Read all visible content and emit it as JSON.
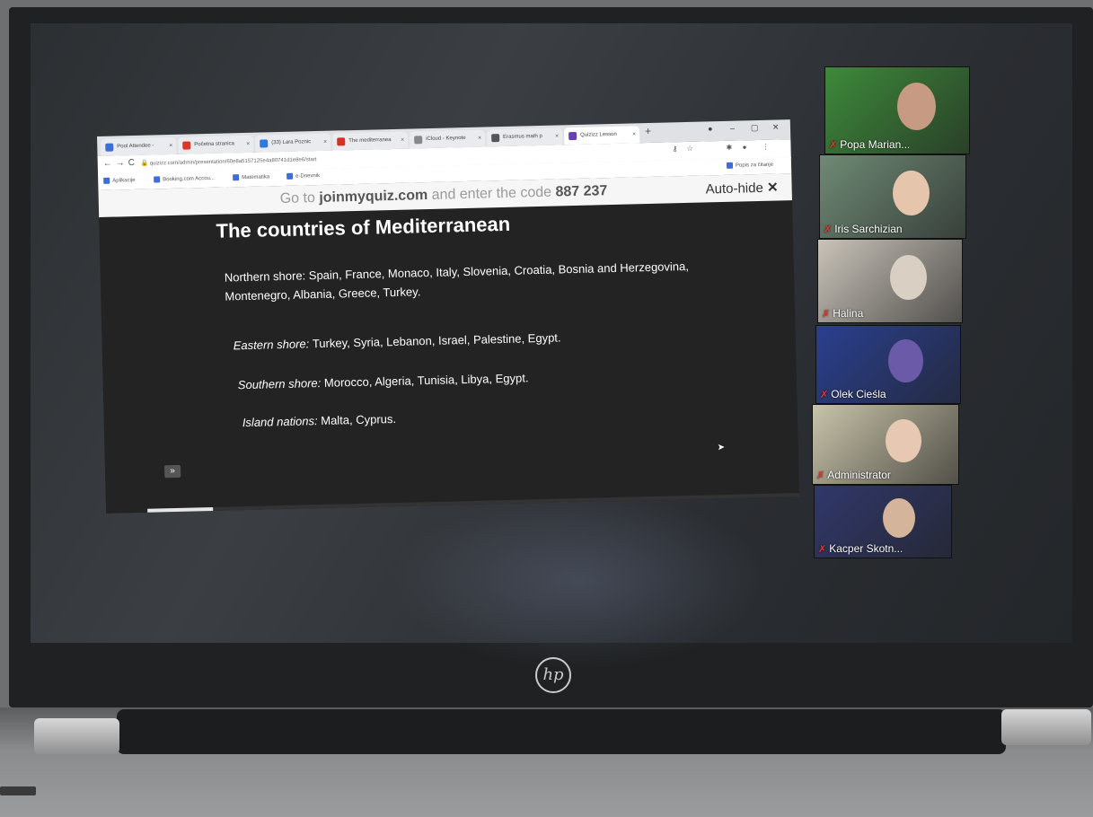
{
  "browser": {
    "tabs": [
      {
        "label": "Pool Attendee -",
        "color": "#3c6ed8"
      },
      {
        "label": "Početna stranica",
        "color": "#e0332b"
      },
      {
        "label": "(33) Lara Poznic",
        "color": "#2e7be0"
      },
      {
        "label": "The mediterranea",
        "color": "#d93025"
      },
      {
        "label": "iCloud - Keynote",
        "color": "#888888"
      },
      {
        "label": "Erasmus math p",
        "color": "#555555"
      },
      {
        "label": "Quizizz Lesson",
        "color": "#6c3fb5",
        "active": true
      }
    ],
    "url": "quizizz.com/admin/presentation/60e8a5157125e4a80741d1e8e6/start",
    "bookmarks": [
      "Aplikacije",
      "Booking.com Accou...",
      "Matematika",
      "e-Dnevnik",
      "Popis za čitanje"
    ]
  },
  "banner": {
    "prefix": "Go to",
    "site": "joinmyquiz.com",
    "middle": "and enter the code",
    "code": "887 237",
    "autohide_label": "Auto-hide"
  },
  "slide": {
    "title": "The countries of Mediterranean",
    "paragraphs": [
      {
        "label": "Northern shore:",
        "text": "Spain, France, Monaco, Italy, Slovenia, Croatia, Bosnia and Herzegovina, Montenegro, Albania, Greece, Turkey.",
        "italic": false
      },
      {
        "label": "Eastern shore:",
        "text": "Turkey, Syria, Lebanon, Israel, Palestine, Egypt.",
        "italic": true
      },
      {
        "label": "Southern shore:",
        "text": "Morocco, Algeria, Tunisia, Libya, Egypt.",
        "italic": true
      },
      {
        "label": "Island nations:",
        "text": "Malta, Cyprus.",
        "italic": true
      }
    ],
    "next_icon": "double-chevron-right-icon",
    "progress": 0.1
  },
  "participants": [
    {
      "name": "Popa Marian...",
      "bg": "#3d8a3a",
      "face": "#c79a83"
    },
    {
      "name": "Iris Sarchizian",
      "bg": "#6f8a75",
      "face": "#e6c5ad"
    },
    {
      "name": "Halina",
      "bg": "#c9c3b9",
      "face": "#d9cfc2"
    },
    {
      "name": "Olek Cieśla",
      "bg": "#2a3f8f",
      "face": "#6a5aa8"
    },
    {
      "name": "Administrator",
      "bg": "#c8c3a9",
      "face": "#e7c8b2"
    },
    {
      "name": "Kacper Skotn...",
      "bg": "#30386b",
      "face": "#d4b49a"
    }
  ],
  "laptop": {
    "brand": "hp"
  }
}
